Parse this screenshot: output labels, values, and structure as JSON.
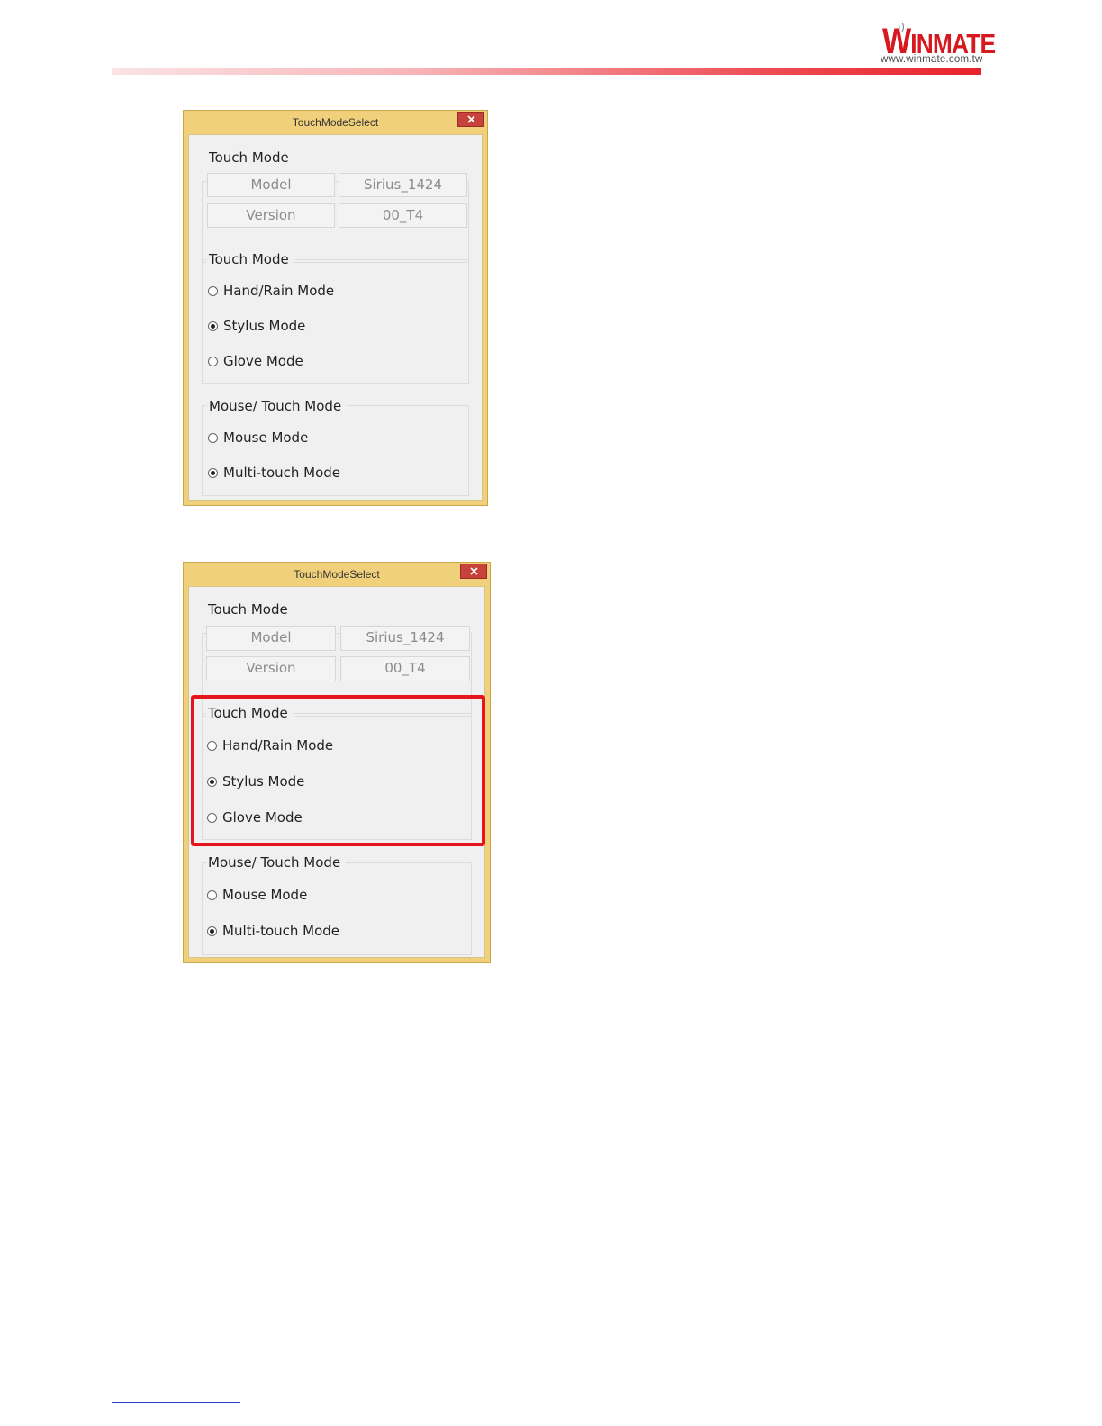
{
  "header": {
    "logo_word": "WINMATE",
    "logo_w": "W",
    "logo_rest": "INMATE",
    "logo_url": "www.winmate.com.tw",
    "accent_color": "#e8222b"
  },
  "dialogs": [
    {
      "title": "TouchModeSelect",
      "close_icon": "close-icon",
      "info_group": {
        "label": "Touch Mode",
        "model_label": "Model",
        "model_value": "Sirius_1424",
        "version_label": "Version",
        "version_value": "00_T4"
      },
      "touch_group": {
        "label": "Touch Mode",
        "options": [
          {
            "label": "Hand/Rain Mode",
            "selected": false
          },
          {
            "label": "Stylus Mode",
            "selected": true
          },
          {
            "label": "Glove Mode",
            "selected": false
          }
        ]
      },
      "mouse_group": {
        "label": "Mouse/ Touch Mode",
        "options": [
          {
            "label": "Mouse Mode",
            "selected": false
          },
          {
            "label": "Multi-touch Mode",
            "selected": true
          }
        ]
      }
    },
    {
      "title": "TouchModeSelect",
      "close_icon": "close-icon",
      "highlight_color": "#e8141c",
      "info_group": {
        "label": "Touch Mode",
        "model_label": "Model",
        "model_value": "Sirius_1424",
        "version_label": "Version",
        "version_value": "00_T4"
      },
      "touch_group": {
        "label": "Touch Mode",
        "options": [
          {
            "label": "Hand/Rain Mode",
            "selected": false
          },
          {
            "label": "Stylus Mode",
            "selected": true
          },
          {
            "label": "Glove Mode",
            "selected": false
          }
        ]
      },
      "mouse_group": {
        "label": "Mouse/ Touch Mode",
        "options": [
          {
            "label": "Mouse Mode",
            "selected": false
          },
          {
            "label": "Multi-touch Mode",
            "selected": true
          }
        ]
      }
    }
  ]
}
